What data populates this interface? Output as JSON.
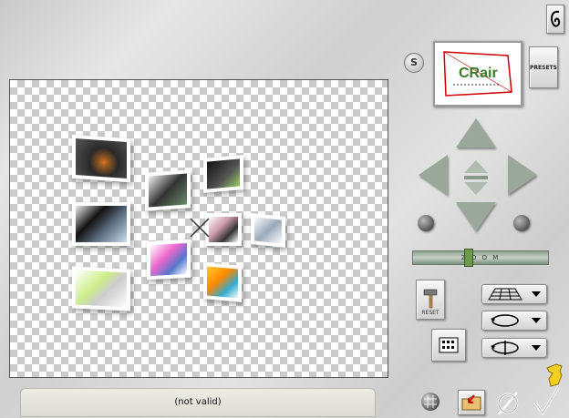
{
  "status_text": "(not valid)",
  "reset_label": "RESET",
  "presets_label": "PRESETS",
  "s_label": "S",
  "preview_logo": "CRair",
  "zoom_label": "Z O O M",
  "colors": {
    "nav_arrow": "#9aa89a",
    "status_bg": "#e4e4da",
    "checker": "#cbcbcb"
  },
  "icons": {
    "top_right": "signature-icon",
    "s_button": "s-circle-icon",
    "reset": "hammer-icon",
    "perspective": "grid-plane-icon",
    "rotate_h": "rotate-horizontal-icon",
    "rotate_v": "rotate-vertical-icon",
    "layout": "layout-grid-icon",
    "grid_toggle": "grid-ball-icon",
    "open": "folder-open-icon",
    "cancel": "cancel-slash-icon",
    "ok": "checkmark-icon",
    "help": "pointing-hand-icon"
  }
}
